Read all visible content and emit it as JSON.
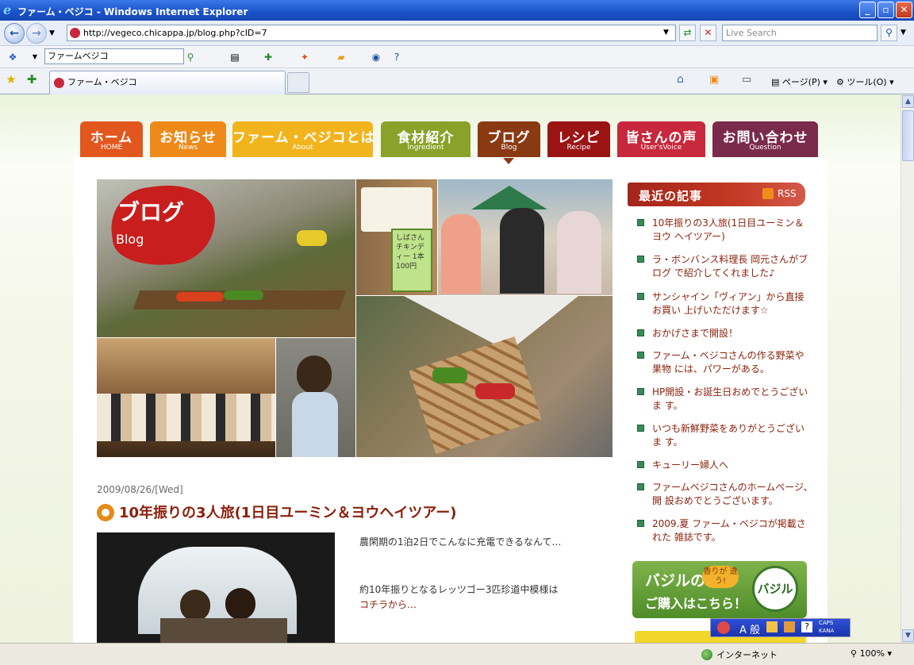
{
  "window": {
    "title": "ファーム・ベジコ - Windows Internet Explorer"
  },
  "address": {
    "url": "http://vegeco.chicappa.jp/blog.php?cID=7",
    "live_search_placeholder": "Live Search"
  },
  "google_toolbar": {
    "search_value": "ファームベジコ"
  },
  "tabs": [
    {
      "label": "ファーム・ベジコ"
    }
  ],
  "command_bar": {
    "page_label": "ページ(P)",
    "tools_label": "ツール(O)"
  },
  "site": {
    "nav": [
      {
        "jp": "ホーム",
        "en": "HOME",
        "color": "#e2571d"
      },
      {
        "jp": "お知らせ",
        "en": "News",
        "color": "#ee8a1a"
      },
      {
        "jp": "ファーム・ベジコとは",
        "en": "About",
        "color": "#f2b41c"
      },
      {
        "jp": "食材紹介",
        "en": "Ingredient",
        "color": "#8ba22a"
      },
      {
        "jp": "ブログ",
        "en": "Blog",
        "color": "#8a3a12"
      },
      {
        "jp": "レシピ",
        "en": "Recipe",
        "color": "#9a1414"
      },
      {
        "jp": "皆さんの声",
        "en": "User'sVoice",
        "color": "#c8283c"
      },
      {
        "jp": "お問い合わせ",
        "en": "Question",
        "color": "#7a2a4a"
      }
    ],
    "hero": {
      "title_jp": "ブログ",
      "title_en": "Blog",
      "sign_text": "しばさん チキンディー 1本 100円"
    },
    "post": {
      "date": "2009/08/26/[Wed]",
      "title": "10年振りの3人旅(1日目ユーミン＆ヨウヘイツアー)",
      "line1": "農閑期の1泊2日でこんなに充電できるなんて…",
      "line2": "約10年振りとなるレッツゴー3匹珍道中模様は",
      "line3": "コチラから…"
    },
    "sidebar": {
      "heading": "最近の記事",
      "rss_label": "RSS",
      "items": [
        "10年振りの3人旅(1日目ユーミン＆ヨウ ヘイツアー)",
        "ラ・ボンバンス料理長 岡元さんがブログ で紹介してくれました♪",
        "サンシャイン「ヴィアン」から直接お買い 上げいただけます☆",
        "おかげさまで開設！",
        "ファーム・ベジコさんの作る野菜や果物 には、パワーがある。",
        "HP開設・お誕生日おめでとうございま す。",
        "いつも新鮮野菜をありがとうございま す。",
        "キューリー婦人へ",
        "ファームベジコさんのホームページ、開 設おめでとうございます。",
        "2009.夏 ファーム・ベジコが掲載された 雑誌です。"
      ],
      "banner": {
        "line1": "バジルの",
        "line2": "ご購入はこちら！",
        "tag": "香りが 違う!",
        "seal": "バジル"
      }
    }
  },
  "status": {
    "zone": "インターネット",
    "zoom": "100%"
  },
  "ime": {
    "mode": "A 般",
    "caps": "CAPS",
    "kana": "KANA"
  }
}
